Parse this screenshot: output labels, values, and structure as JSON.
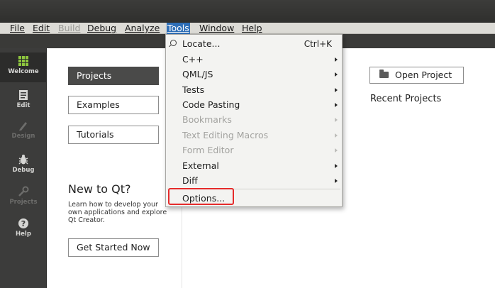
{
  "menubar": {
    "file": "File",
    "edit": "Edit",
    "build": "Build",
    "debug": "Debug",
    "analyze": "Analyze",
    "tools": "Tools",
    "window": "Window",
    "help": "Help"
  },
  "modebar": {
    "welcome": "Welcome",
    "edit": "Edit",
    "design": "Design",
    "debug": "Debug",
    "projects": "Projects",
    "help": "Help"
  },
  "welcome": {
    "projects": "Projects",
    "examples": "Examples",
    "tutorials": "Tutorials",
    "new_title": "New to Qt?",
    "new_desc": "Learn how to develop your own applications and explore Qt Creator.",
    "get_started": "Get Started Now",
    "open_project": "Open Project",
    "recent_projects": "Recent Projects"
  },
  "tools_menu": {
    "locate": "Locate...",
    "locate_shortcut": "Ctrl+K",
    "cpp": "C++",
    "qml": "QML/JS",
    "tests": "Tests",
    "code_pasting": "Code Pasting",
    "bookmarks": "Bookmarks",
    "text_macros": "Text Editing Macros",
    "form_editor": "Form Editor",
    "external": "External",
    "diff": "Diff",
    "options": "Options..."
  },
  "colors": {
    "menu_highlight": "#2f6fb7",
    "callout_red": "#e52b2b",
    "welcome_green": "#8ec63f"
  }
}
